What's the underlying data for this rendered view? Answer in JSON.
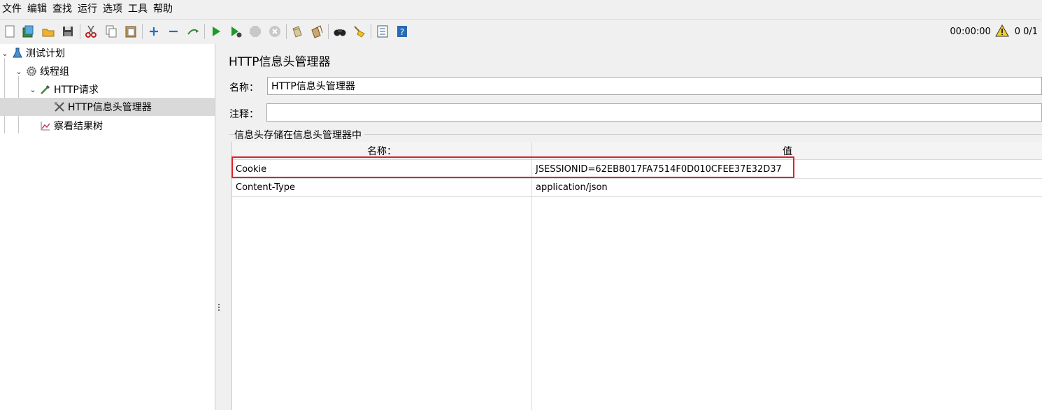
{
  "menu": [
    "文件",
    "编辑",
    "查找",
    "运行",
    "选项",
    "工具",
    "帮助"
  ],
  "toolbar": {
    "icons": [
      "new-icon",
      "templates-icon",
      "open-icon",
      "save-icon",
      "cut-icon",
      "copy-icon",
      "paste-icon",
      "expand-icon",
      "collapse-icon",
      "toggle-icon",
      "start-icon",
      "start-no-pause-icon",
      "stop-icon",
      "shutdown-icon",
      "clear-icon",
      "clear-all-icon",
      "search-icon",
      "reset-search-icon",
      "function-helper-icon",
      "help-icon"
    ],
    "timer": "00:00:00",
    "warning_count": "0",
    "threads": "0/1"
  },
  "tree": {
    "items": [
      {
        "label": "测试计划",
        "icon": "flask-icon"
      },
      {
        "label": "线程组",
        "icon": "gear-icon"
      },
      {
        "label": "HTTP请求",
        "icon": "pipette-icon"
      },
      {
        "label": "HTTP信息头管理器",
        "icon": "tools-icon"
      },
      {
        "label": "察看结果树",
        "icon": "graph-icon"
      }
    ]
  },
  "panel": {
    "title": "HTTP信息头管理器",
    "name_label": "名称：",
    "name_value": "HTTP信息头管理器",
    "comment_label": "注释：",
    "comment_value": "",
    "group_title": "信息头存储在信息头管理器中"
  },
  "table": {
    "columns": [
      "名称：",
      "值"
    ],
    "rows": [
      {
        "name": "Cookie",
        "value": "JSESSIONID=62EB8017FA7514F0D010CFEE37E32D37"
      },
      {
        "name": "Content-Type",
        "value": "application/json"
      }
    ]
  },
  "colors": {
    "highlight": "#e0202a",
    "selected_row": "#d9d9d9"
  }
}
